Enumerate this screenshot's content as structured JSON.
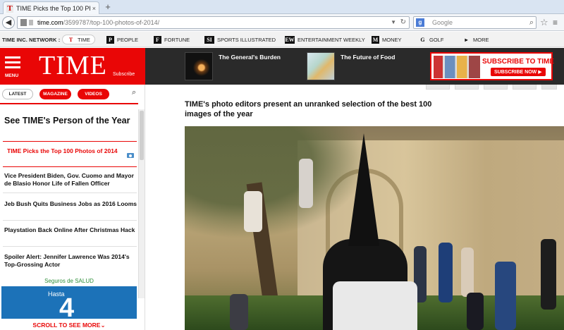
{
  "browser": {
    "tab_title": "TIME Picks the Top 100 Ph...",
    "tab_favicon": "T",
    "url_host": "time.com",
    "url_path": "/3599787/top-100-photos-of-2014/",
    "search_placeholder": "Google"
  },
  "network": {
    "label": "TIME INC. NETWORK :",
    "items": [
      {
        "icon": "T",
        "label": "TIME"
      },
      {
        "icon": "P",
        "label": "PEOPLE"
      },
      {
        "icon": "F",
        "label": "FORTUNE"
      },
      {
        "icon": "SI",
        "label": "SPORTS ILLUSTRATED"
      },
      {
        "icon": "EW",
        "label": "ENTERTAINMENT WEEKLY"
      },
      {
        "icon": "M",
        "label": "MONEY"
      },
      {
        "icon": "G",
        "label": "GOLF"
      },
      {
        "icon": "▸",
        "label": "MORE"
      }
    ]
  },
  "header": {
    "menu_label": "MENU",
    "logo": "TIME",
    "subscribe_link": "Subscribe",
    "stories": [
      {
        "title": "The General's Burden"
      },
      {
        "title": "The Future of Food"
      }
    ],
    "ad_title": "SUBSCRIBE TO TIME",
    "ad_button": "SUBSCRIBE NOW ▶"
  },
  "sidebar": {
    "tabs": [
      "LATEST",
      "MAGAZINE",
      "VIDEOS"
    ],
    "person_of_year": "See TIME's Person of the Year",
    "items": [
      {
        "title": "TIME Picks the Top 100 Photos of 2014",
        "active": true
      },
      {
        "title": "Vice President Biden, Gov. Cuomo and Mayor de Blasio Honor Life of Fallen Officer",
        "active": false
      },
      {
        "title": "Jeb Bush Quits Business Jobs as 2016 Looms",
        "active": false
      },
      {
        "title": "Playstation Back Online After Christmas Hack",
        "active": false
      },
      {
        "title": "Spoiler Alert: Jennifer Lawrence Was 2014's Top-Grossing Actor",
        "active": false
      }
    ],
    "ad_label": "Seguros de SALUD",
    "ad_hasta": "Hasta",
    "ad_number": "4",
    "scroll_more": "SCROLL TO SEE MORE"
  },
  "main": {
    "intro": "TIME's photo editors present an unranked selection of the best 100 images of the year"
  }
}
